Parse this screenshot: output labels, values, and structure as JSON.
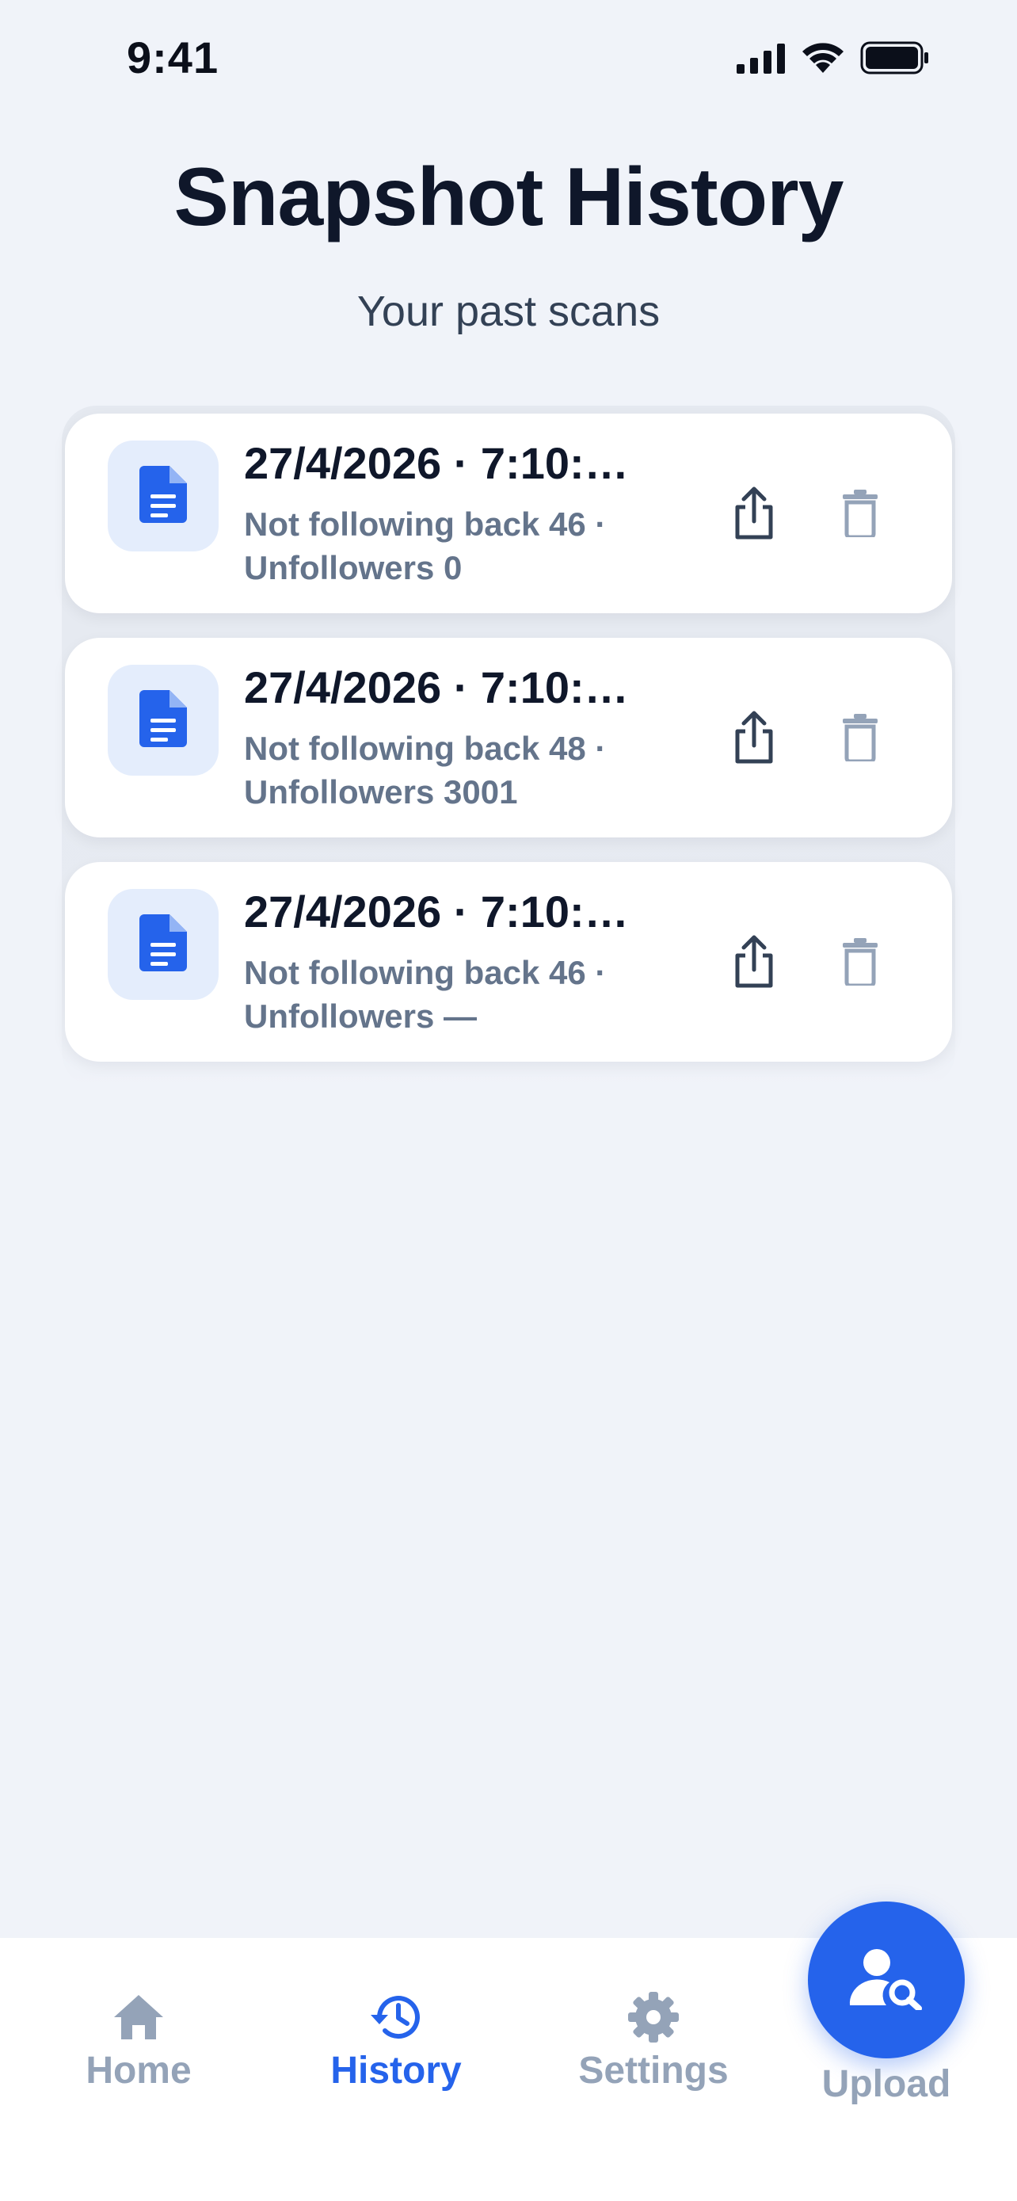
{
  "status_bar": {
    "time": "9:41",
    "icons": [
      "cellular-signal-icon",
      "wifi-icon",
      "battery-icon"
    ]
  },
  "header": {
    "title": "Snapshot History",
    "subtitle": "Your past scans"
  },
  "snapshots": [
    {
      "title": "27/4/2026 · 7:10:…",
      "detail_line1": "Not following back 46 ·",
      "detail_line2": "Unfollowers 0"
    },
    {
      "title": "27/4/2026 · 7:10:…",
      "detail_line1": "Not following back 48 ·",
      "detail_line2": "Unfollowers 3001"
    },
    {
      "title": "27/4/2026 · 7:10:…",
      "detail_line1": "Not following back 46 ·",
      "detail_line2": "Unfollowers —"
    }
  ],
  "tab_bar": {
    "home": "Home",
    "history": "History",
    "settings": "Settings",
    "upload": "Upload",
    "active": "history"
  },
  "colors": {
    "accent": "#2563eb",
    "background": "#f0f3f9",
    "inactive": "#94a3b8",
    "title": "#0f172a",
    "subtext": "#64748b"
  }
}
